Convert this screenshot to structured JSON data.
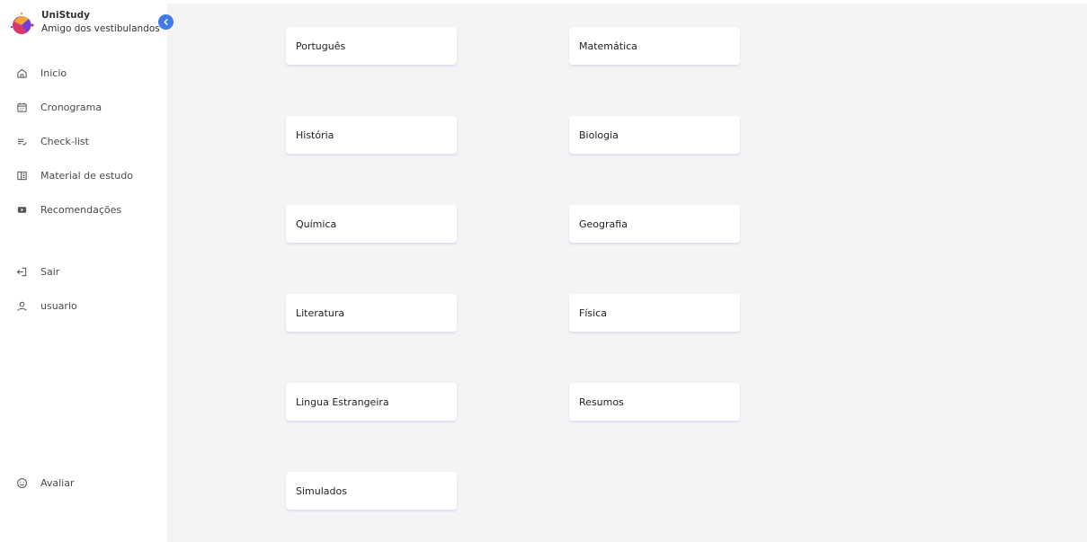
{
  "brand": {
    "title": "UniStudy",
    "subtitle": "Amigo dos vestibulandos"
  },
  "sidebar": {
    "items": [
      {
        "label": "Inicio",
        "icon": "home-icon"
      },
      {
        "label": "Cronograma",
        "icon": "calendar-icon"
      },
      {
        "label": "Check-list",
        "icon": "checklist-icon"
      },
      {
        "label": "Material de estudo",
        "icon": "book-icon"
      },
      {
        "label": "Recomendações",
        "icon": "video-icon"
      }
    ],
    "logout": {
      "label": "Sair",
      "icon": "logout-icon"
    },
    "user": {
      "label": "usuario",
      "icon": "user-icon"
    },
    "rate": {
      "label": "Avaliar",
      "icon": "smiley-icon"
    }
  },
  "subjects": [
    "Português",
    "Matemática",
    "História",
    "Biologia",
    "Química",
    "Geografia",
    "Literatura",
    "Física",
    "Lingua Estrangeira",
    "Resumos",
    "Simulados"
  ],
  "colors": {
    "accent": "#3f7be8",
    "background": "#f4f4f4",
    "card": "#ffffff"
  }
}
